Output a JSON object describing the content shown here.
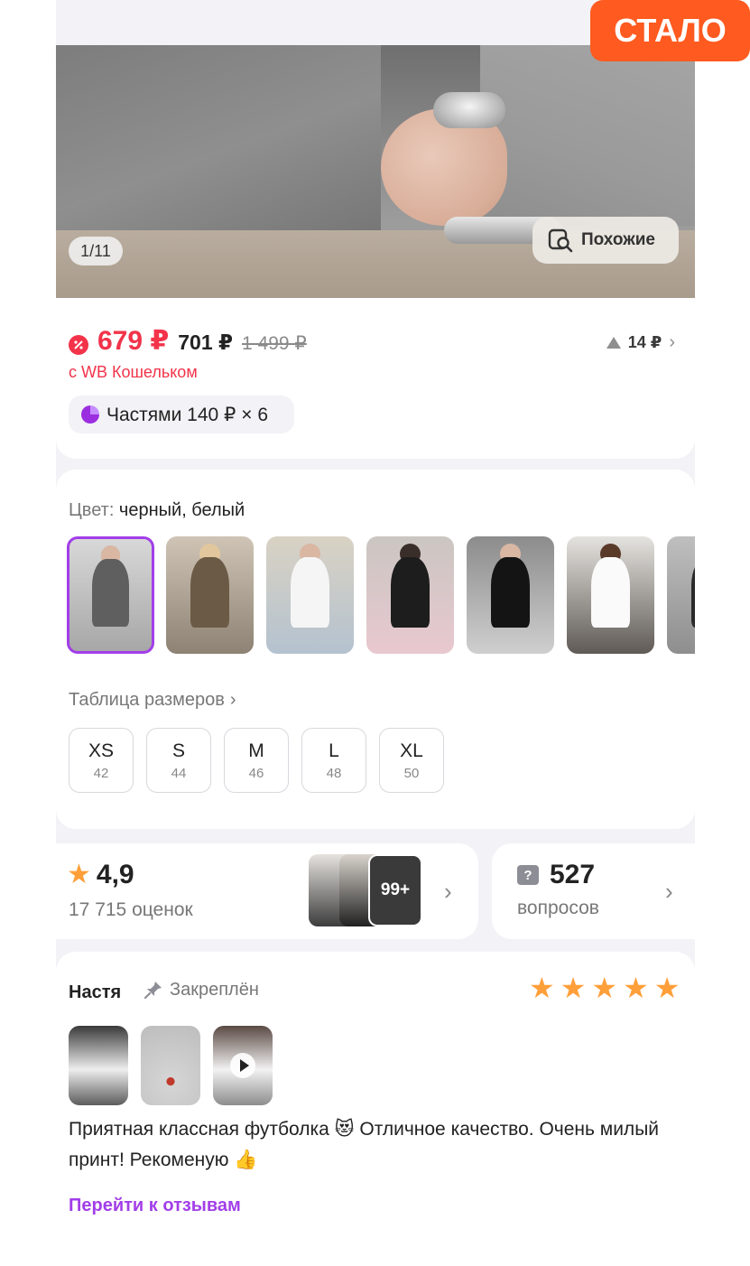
{
  "badge": {
    "label": "СТАЛО",
    "color": "#ff5a1f"
  },
  "gallery": {
    "counter": "1/11",
    "similar_label": "Похожие"
  },
  "price": {
    "main": "679 ₽",
    "regular": "701 ₽",
    "crossed": "1 499 ₽",
    "delta": "14 ₽",
    "wallet_label": "с WB Кошельком",
    "installments": "Частями 140 ₽ × 6",
    "accent_color": "#f2334a"
  },
  "color_selector": {
    "label": "Цвет:",
    "value": " черный, белый",
    "selected_border": "#a23ee8"
  },
  "sizes": {
    "table_link": "Таблица размеров",
    "items": [
      {
        "name": "XS",
        "num": "42"
      },
      {
        "name": "S",
        "num": "44"
      },
      {
        "name": "M",
        "num": "46"
      },
      {
        "name": "L",
        "num": "48"
      },
      {
        "name": "XL",
        "num": "50"
      }
    ]
  },
  "rating": {
    "value": "4,9",
    "count": "17 715 оценок",
    "more_photos": "99+"
  },
  "questions": {
    "count": "527",
    "label": "вопросов"
  },
  "review": {
    "author": "Настя",
    "pinned": "Закреплён",
    "stars": 5,
    "text": "Приятная классная футболка 😻 Отличное качество. Очень милый принт! Рекоменую 👍",
    "link": "Перейти к отзывам"
  }
}
